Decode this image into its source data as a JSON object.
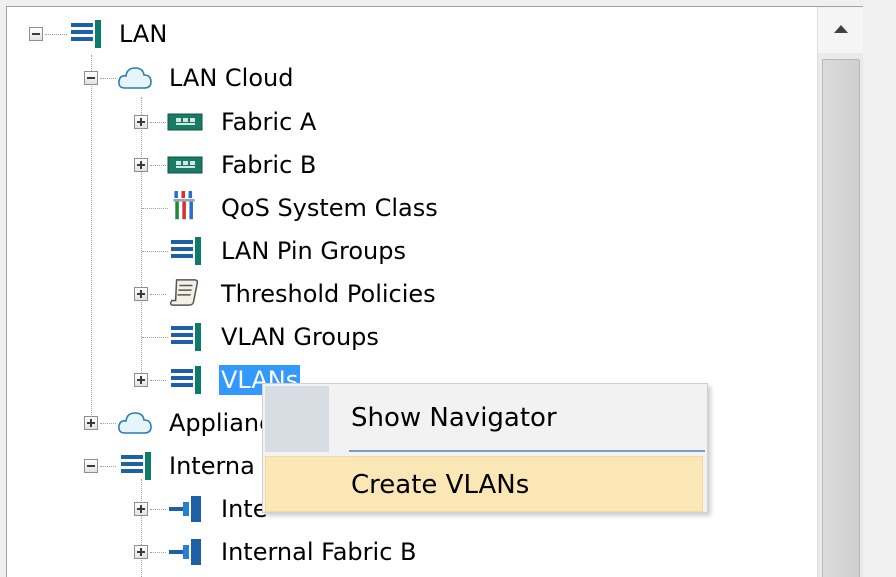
{
  "tree": {
    "items": [
      {
        "label": "LAN",
        "icon": "lan-icon",
        "expander": "minus"
      },
      {
        "label": "LAN Cloud",
        "icon": "cloud-icon",
        "expander": "minus"
      },
      {
        "label": "Fabric A",
        "icon": "fabric-icon",
        "expander": "plus"
      },
      {
        "label": "Fabric B",
        "icon": "fabric-icon",
        "expander": "plus"
      },
      {
        "label": "QoS System Class",
        "icon": "qos-icon",
        "expander": "none"
      },
      {
        "label": "LAN Pin Groups",
        "icon": "lan-icon",
        "expander": "none"
      },
      {
        "label": "Threshold Policies",
        "icon": "scroll-icon",
        "expander": "plus"
      },
      {
        "label": "VLAN Groups",
        "icon": "lan-icon",
        "expander": "none"
      },
      {
        "label": "VLANs",
        "icon": "lan-icon",
        "expander": "plus",
        "selected": true
      },
      {
        "label": "Applianc",
        "icon": "cloud-icon",
        "expander": "plus"
      },
      {
        "label": "Interna",
        "icon": "lan-icon",
        "expander": "minus"
      },
      {
        "label": "Inte",
        "icon": "internal-fabric-icon",
        "expander": "plus"
      },
      {
        "label": "Internal Fabric B",
        "icon": "internal-fabric-icon",
        "expander": "plus"
      }
    ]
  },
  "context_menu": {
    "items": [
      {
        "label": "Show Navigator"
      },
      {
        "label": "Create VLANs",
        "highlighted": true
      }
    ]
  },
  "colors": {
    "selection": "#3399ff",
    "menu_highlight": "#fbe7b5",
    "lan_icon_blue": "#1f5fa8",
    "lan_icon_teal": "#0c7b6a"
  }
}
